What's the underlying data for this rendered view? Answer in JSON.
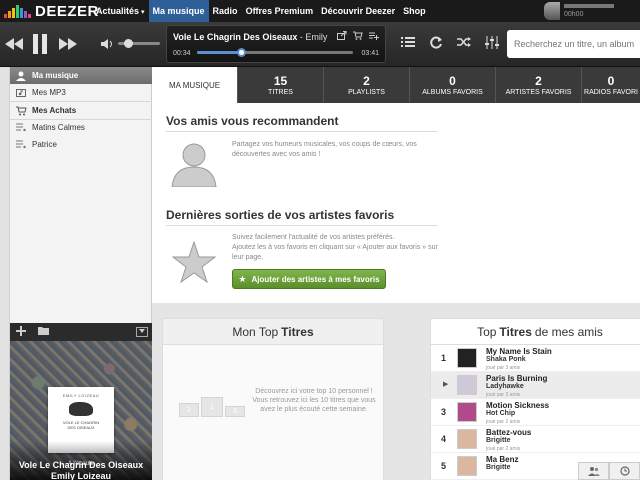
{
  "brand": {
    "name": "DEEZER"
  },
  "nav": {
    "items": [
      {
        "label": "Actualités",
        "caret": "▾"
      },
      {
        "label": "Ma musique"
      },
      {
        "label": "Radio"
      },
      {
        "label": "Offres Premium"
      },
      {
        "label": "Découvrir Deezer"
      },
      {
        "label": "Shop"
      }
    ],
    "active_index": 1
  },
  "user": {
    "time": "00h00"
  },
  "player": {
    "track_title": "Vole Le Chagrin Des Oiseaux",
    "track_artist": " - Emily",
    "elapsed": "00:34",
    "duration": "03:41",
    "progress_fraction": 0.28,
    "volume_fraction": 0.3
  },
  "search": {
    "placeholder": "Recherchez un titre, un album"
  },
  "sidebar": {
    "items": [
      {
        "label": "Ma musique",
        "icon": "user-icon"
      },
      {
        "label": "Mes MP3",
        "icon": "music-file-icon"
      },
      {
        "label": "Mes Achats",
        "icon": "cart-icon"
      },
      {
        "label": "Matins Calmes",
        "icon": "playlist-icon"
      },
      {
        "label": "Patrice",
        "icon": "playlist-icon"
      }
    ]
  },
  "now_playing": {
    "listening_label": "A l'écoute",
    "title": "Vole Le Chagrin Des Oiseaux",
    "artist": "Emily Loizeau",
    "cover_top": "EMILY LOIZEAU",
    "cover_title": "VOLE LE CHAGRIN DES OISEAUX"
  },
  "tabs": [
    {
      "count": "",
      "label": "MA MUSIQUE"
    },
    {
      "count": "15",
      "label": "TITRES"
    },
    {
      "count": "2",
      "label": "PLAYLISTS"
    },
    {
      "count": "0",
      "label": "ALBUMS FAVORIS"
    },
    {
      "count": "2",
      "label": "ARTISTES FAVORIS"
    },
    {
      "count": "0",
      "label": "RADIOS FAVORI"
    }
  ],
  "friends_section": {
    "title": "Vos amis vous recommandent",
    "desc": "Partagez vos humeurs musicales, vos coups de cœurs, vos découvertes avec vos amis !"
  },
  "releases_section": {
    "title": "Dernières sorties de vos artistes favoris",
    "desc1": "Suivez facilement l'actualité de vos artistes préférés.",
    "desc2": "Ajoutez les à vos favoris en cliquant sur « Ajouter aux favoris » sur leur page.",
    "button": "Ajouter des artistes à mes favoris"
  },
  "top_titres": {
    "title_light": "Mon Top",
    "title_bold": "Titres",
    "desc": "Découvrez ici votre top 10 personnel ! Vous retrouvez ici les 10 titres que vous avez le plus écouté cette semaine.",
    "podium": [
      "2",
      "1",
      "3"
    ]
  },
  "top_amis": {
    "title_light": "Top",
    "title_bold": "Titres",
    "title_suffix": "de mes amis",
    "rows": [
      {
        "rank": "1",
        "title": "My Name Is Stain",
        "artist": "Shaka Ponk",
        "meta": "joué par 3 amis",
        "color": "#222"
      },
      {
        "rank": "▶",
        "title": "Paris Is Burning",
        "artist": "Ladyhawke",
        "meta": "joué par 3 amis",
        "color": "#cfc8d6"
      },
      {
        "rank": "3",
        "title": "Motion Sickness",
        "artist": "Hot Chip",
        "meta": "joué par 2 amis",
        "color": "#b04a8a"
      },
      {
        "rank": "4",
        "title": "Battez-vous",
        "artist": "Brigitte",
        "meta": "joué par 2 amis",
        "color": "#d9b7a0"
      },
      {
        "rank": "5",
        "title": "Ma Benz",
        "artist": "Brigitte",
        "meta": "",
        "color": "#d9b7a0"
      }
    ]
  },
  "colors": {
    "accent": "#2f5f99",
    "green_button": "#6aa33a",
    "progress": "#5b8fd0",
    "logo_bars": [
      "#e74c3c",
      "#f39c12",
      "#f1c40f",
      "#2ecc71",
      "#3498db",
      "#9b59b6",
      "#e84393"
    ]
  }
}
